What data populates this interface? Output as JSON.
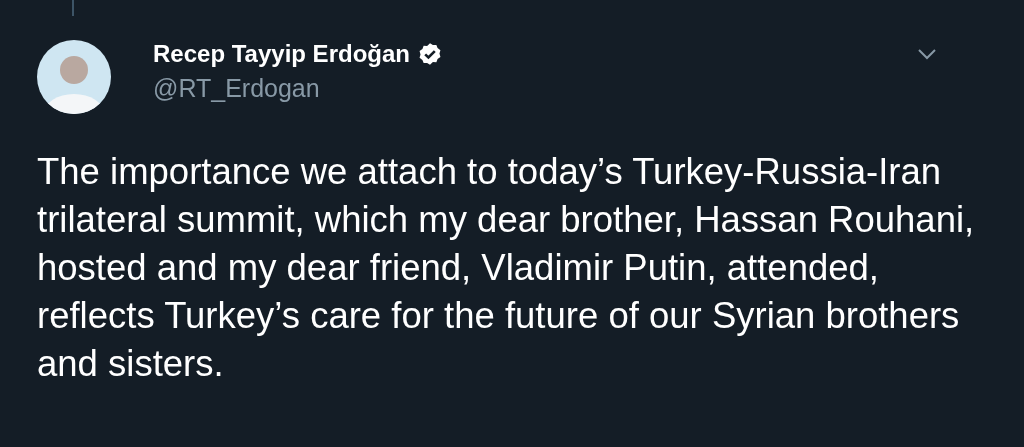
{
  "thread_line": {
    "visible": true
  },
  "author": {
    "name": "Recep Tayyip Erdoğan",
    "verified": true,
    "handle": "@RT_Erdogan"
  },
  "tweet": {
    "text": "The importance we attach to today’s Turkey-Russia-Iran trilateral summit, which my dear brother, Hassan Rouhani, hosted and my dear friend, Vladimir Putin, attended, reflects Turkey’s care for the future of our Syrian brothers and sisters."
  }
}
